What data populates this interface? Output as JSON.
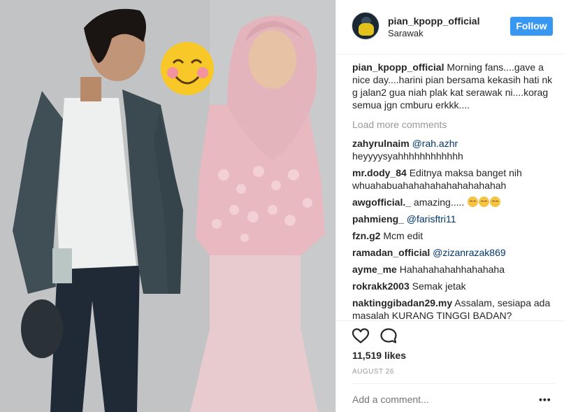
{
  "post": {
    "username": "pian_kpopp_official",
    "location": "Sarawak",
    "follow_label": "Follow",
    "caption_text": " Morning fans....gave a nice day....harini pian bersama kekasih hati nk g jalan2 gua niah plak kat serawak ni....korag semua jgn cmburu erkkk....",
    "load_more": "Load more comments",
    "likes": "11,519 likes",
    "date": "AUGUST 26",
    "add_comment_placeholder": "Add a comment...",
    "more_options": "•••"
  },
  "comments": [
    {
      "user": "zahyrulnaim",
      "mention": "@rah.azhr",
      "text": ""
    },
    {
      "user": "",
      "mention": "",
      "text": "heyyyysyahhhhhhhhhhhh"
    },
    {
      "user": "mr.dody_84",
      "mention": "",
      "text": " Editnya maksa banget nih whuahabuahahahahahahahahahah"
    },
    {
      "user": "awgofficial._",
      "mention": "",
      "text": " amazing....."
    },
    {
      "user": "pahmieng_",
      "mention": "@farisftri11",
      "text": ""
    },
    {
      "user": "fzn.g2",
      "mention": "",
      "text": " Mcm edit"
    },
    {
      "user": "ramadan_official",
      "mention": "@zizanrazak869",
      "text": ""
    },
    {
      "user": "ayme_me",
      "mention": "",
      "text": " Hahahahahahhahahaha"
    },
    {
      "user": "rokrakk2003",
      "mention": "",
      "text": " Semak jetak"
    },
    {
      "user": "naktinggibadan29.my",
      "mention": "",
      "text": " Assalam, sesiapa ada masalah KURANG TINGGI BADAN?"
    }
  ],
  "colors": {
    "accent": "#3897f0",
    "muted": "#999999",
    "mention": "#003569"
  },
  "icons": [
    "heart-icon",
    "comment-icon",
    "smiling-face-emoji",
    "expressionless-face-emoji"
  ]
}
